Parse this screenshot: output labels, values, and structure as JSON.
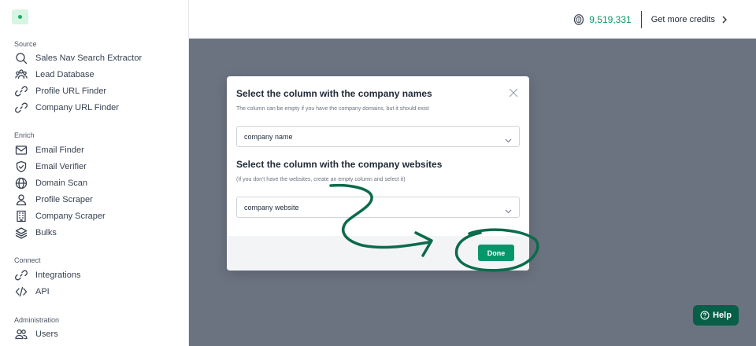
{
  "colors": {
    "accent": "#059669",
    "overlay": "#6b7280",
    "help_bg": "#065f46",
    "annotation": "#0b6b4a"
  },
  "sidebar": {
    "sections": [
      {
        "label": "Source",
        "items": [
          {
            "label": "Sales Nav Search Extractor",
            "icon": "search-icon"
          },
          {
            "label": "Lead Database",
            "icon": "users-icon"
          },
          {
            "label": "Profile URL Finder",
            "icon": "link-icon"
          },
          {
            "label": "Company URL Finder",
            "icon": "link-icon"
          }
        ]
      },
      {
        "label": "Enrich",
        "items": [
          {
            "label": "Email Finder",
            "icon": "mail-icon"
          },
          {
            "label": "Email Verifier",
            "icon": "check-shield-icon"
          },
          {
            "label": "Domain Scan",
            "icon": "globe-icon"
          },
          {
            "label": "Profile Scraper",
            "icon": "user-icon"
          },
          {
            "label": "Company Scraper",
            "icon": "building-icon"
          },
          {
            "label": "Bulks",
            "icon": "layers-icon"
          }
        ]
      },
      {
        "label": "Connect",
        "items": [
          {
            "label": "Integrations",
            "icon": "link-icon"
          },
          {
            "label": "API",
            "icon": "code-icon"
          }
        ]
      },
      {
        "label": "Administration",
        "items": [
          {
            "label": "Users",
            "icon": "users-icon"
          }
        ]
      }
    ]
  },
  "topbar": {
    "credits_value": "9,519,331",
    "more_credits_label": "Get more credits"
  },
  "modal": {
    "title": "Select the column with the company names",
    "subtitle": "The column can be empty if you have the company domains, but it should exist",
    "select1_value": "company name",
    "title2": "Select the column with the company websites",
    "subtitle2": "(If you don't have the websites, create an empty column and select it)",
    "select2_value": "company website",
    "done_label": "Done"
  },
  "help": {
    "label": "Help"
  }
}
